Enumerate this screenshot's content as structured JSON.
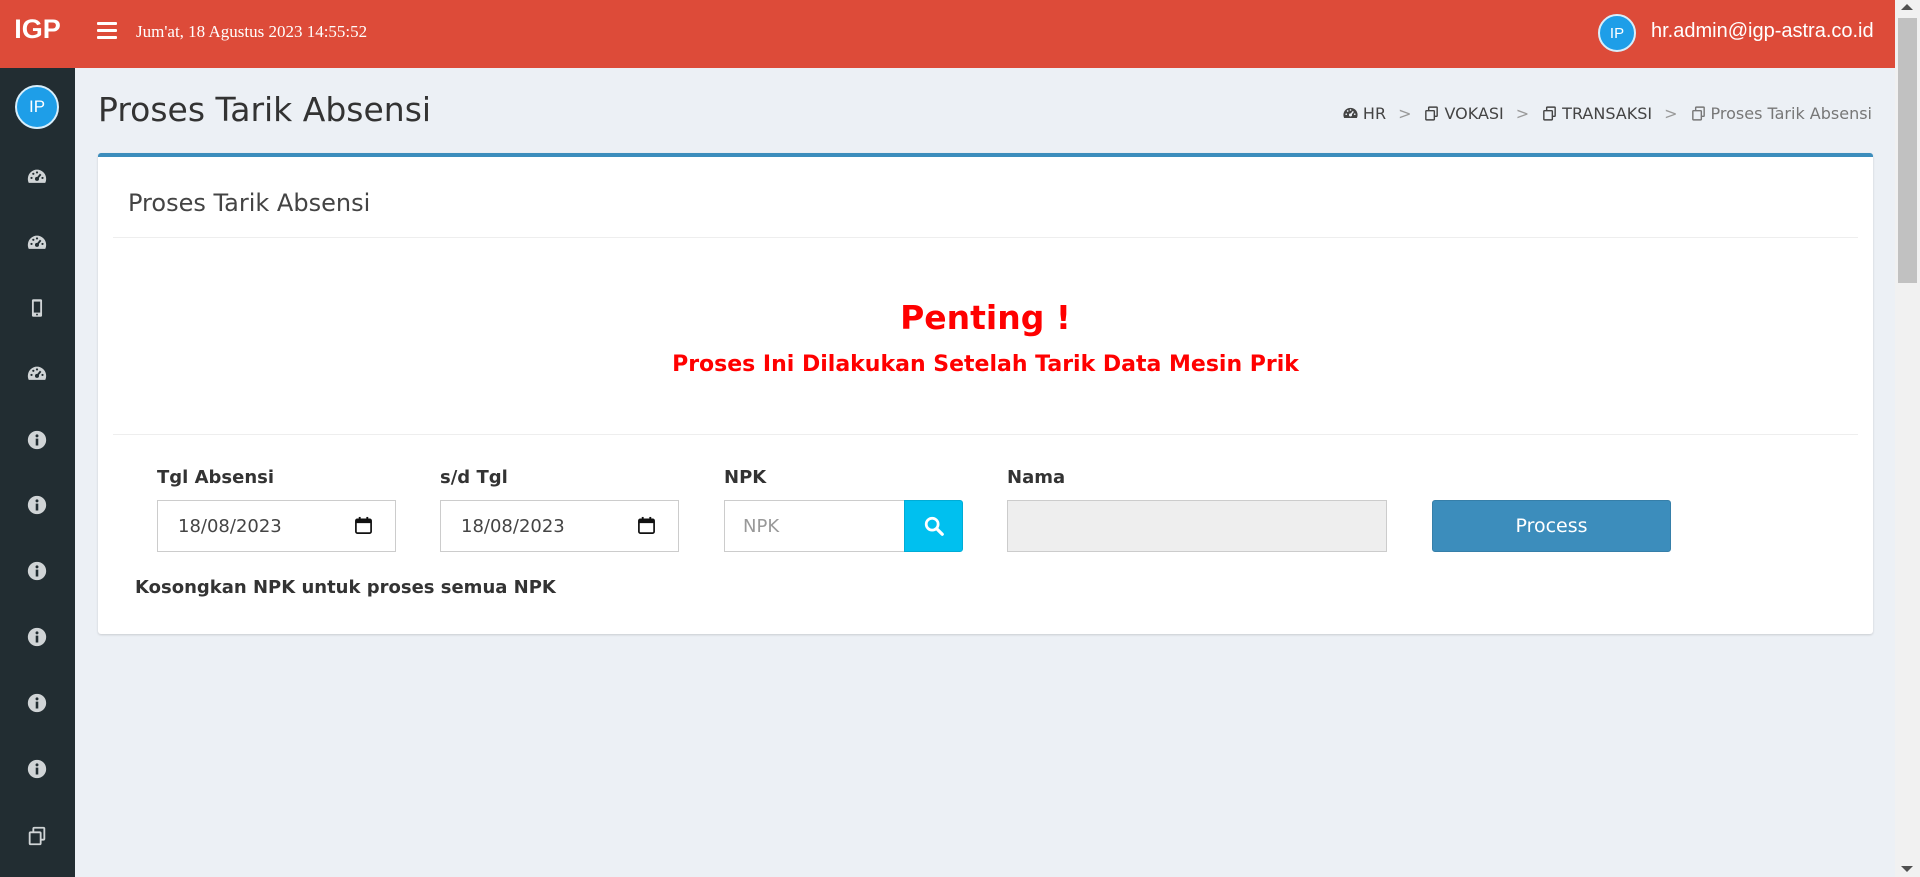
{
  "app": {
    "logo": "IGP",
    "avatar_initials": "IP"
  },
  "header": {
    "datetime": "Jum'at, 18 Agustus 2023 14:55:52",
    "user_initials": "IP",
    "user_email": "hr.admin@igp-astra.co.id",
    "accent_color": "#dd4b39"
  },
  "sidebar": {
    "items": [
      {
        "icon": "dashboard-icon"
      },
      {
        "icon": "dashboard-icon"
      },
      {
        "icon": "mobile-icon"
      },
      {
        "icon": "dashboard-icon"
      },
      {
        "icon": "info-icon"
      },
      {
        "icon": "info-icon"
      },
      {
        "icon": "info-icon"
      },
      {
        "icon": "info-icon"
      },
      {
        "icon": "info-icon"
      },
      {
        "icon": "info-icon"
      },
      {
        "icon": "copy-icon"
      }
    ]
  },
  "page": {
    "title": "Proses Tarik Absensi"
  },
  "breadcrumb": [
    {
      "label": "HR",
      "icon": "dashboard-icon"
    },
    {
      "label": "VOKASI",
      "icon": "copy-icon"
    },
    {
      "label": "TRANSAKSI",
      "icon": "copy-icon"
    },
    {
      "label": "Proses Tarik Absensi",
      "icon": "copy-icon"
    }
  ],
  "box": {
    "title": "Proses Tarik Absensi",
    "alert_title": "Penting !",
    "alert_subtitle": "Proses Ini Dilakukan Setelah Tarik Data Mesin Prik",
    "form": {
      "tgl_absensi_label": "Tgl Absensi",
      "tgl_absensi_value": "18/08/2023",
      "sd_tgl_label": "s/d Tgl",
      "sd_tgl_value": "18/08/2023",
      "npk_label": "NPK",
      "npk_placeholder": "NPK",
      "nama_label": "Nama",
      "nama_value": "",
      "process_label": "Process"
    },
    "hint": "Kosongkan NPK untuk proses semua NPK"
  }
}
